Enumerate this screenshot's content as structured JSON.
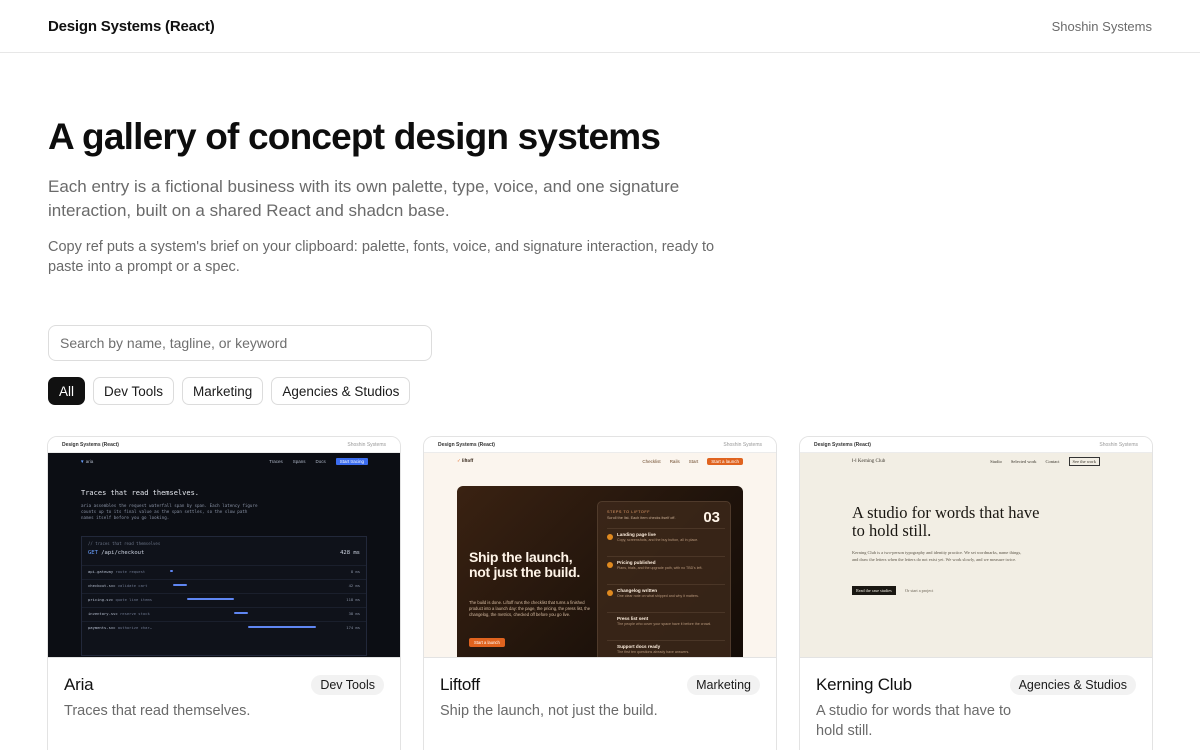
{
  "header": {
    "brand": "Design Systems (React)",
    "org": "Shoshin Systems"
  },
  "hero": {
    "title": "A gallery of concept design systems",
    "lead": "Each entry is a fictional business with its own palette, type, voice, and one signature interaction, built on a shared React and shadcn base.",
    "note": "Copy ref puts a system's brief on your clipboard: palette, fonts, voice, and signature interaction, ready to paste into a prompt or a spec."
  },
  "search": {
    "placeholder": "Search by name, tagline, or keyword",
    "value": ""
  },
  "filters": [
    "All",
    "Dev Tools",
    "Marketing",
    "Agencies & Studios"
  ],
  "cards": [
    {
      "title": "Aria",
      "badge": "Dev Tools",
      "desc": "Traces that read themselves.",
      "preview": {
        "mini_brand": "Design Systems (React)",
        "mini_org": "Shoshin Systems",
        "logo": "aria",
        "nav": [
          "Traces",
          "Spans",
          "Docs"
        ],
        "cta": "Start tracing",
        "headline": "Traces that read themselves.",
        "body": "aria assembles the request waterfall span by span. Each latency figure counts up to its final value as the span settles, so the slow path names itself before you go looking.",
        "panel_caption": "// traces that read themselves",
        "method": "GET",
        "route": "/api/checkout",
        "total": "428 ms",
        "spans": [
          {
            "service": "api-gateway",
            "op": "route request",
            "ms": "8 ms",
            "start": 0.02,
            "width": 0.01
          },
          {
            "service": "checkout-svc",
            "op": "validate cart",
            "ms": "42 ms",
            "start": 0.04,
            "width": 0.08
          },
          {
            "service": "pricing-svc",
            "op": "quote line items",
            "ms": "118 ms",
            "start": 0.12,
            "width": 0.26
          },
          {
            "service": "inventory-svc",
            "op": "reserve stock",
            "ms": "38 ms",
            "start": 0.38,
            "width": 0.08
          },
          {
            "service": "payments-svc",
            "op": "authorize char…",
            "ms": "174 ms",
            "start": 0.46,
            "width": 0.38
          }
        ]
      }
    },
    {
      "title": "Liftoff",
      "badge": "Marketing",
      "desc": "Ship the launch, not just the build.",
      "preview": {
        "mini_brand": "Design Systems (React)",
        "mini_org": "Shoshin Systems",
        "logo": "liftoff",
        "nav": [
          "Checklist",
          "Rails",
          "Start"
        ],
        "cta": "Start a launch",
        "headline": "Ship the launch, not just the build.",
        "body": "The build is done. Liftoff runs the checklist that turns a finished product into a launch day: the page, the pricing, the press list, the changelog, the metrics, checked off before you go live.",
        "button": "Start a launch",
        "checklist_label": "STEPS TO LIFTOFF",
        "checklist_sub": "Scroll the list. Each item checks itself off.",
        "count": "03",
        "items": [
          {
            "title": "Landing page live",
            "detail": "Copy, screenshots, and the buy button, all in place.",
            "done": true
          },
          {
            "title": "Pricing published",
            "detail": "Plans, trials, and the upgrade path, with no TBD's left.",
            "done": true
          },
          {
            "title": "Changelog written",
            "detail": "One clear note on what shipped and why it matters.",
            "done": true
          },
          {
            "title": "Press list sent",
            "detail": "The people who cover your space have it before the crowd.",
            "done": false
          },
          {
            "title": "Support docs ready",
            "detail": "The first ten questions already have answers.",
            "done": false
          }
        ]
      }
    },
    {
      "title": "Kerning Club",
      "badge": "Agencies & Studios",
      "desc": "A studio for words that have to hold still.",
      "preview": {
        "mini_brand": "Design Systems (React)",
        "mini_org": "Shoshin Systems",
        "logo": "Kerning Club",
        "nav": [
          "Studio",
          "Selected work",
          "Contact"
        ],
        "cta": "See the work",
        "headline": "A studio for words that have to hold still.",
        "body": "Kerning Club is a two-person typography and identity practice. We set wordmarks, name things, and draw the letters when the letters do not exist yet. We work slowly, and we measure twice.",
        "primary": "Read the case studies",
        "secondary": "Or start a project"
      }
    }
  ]
}
